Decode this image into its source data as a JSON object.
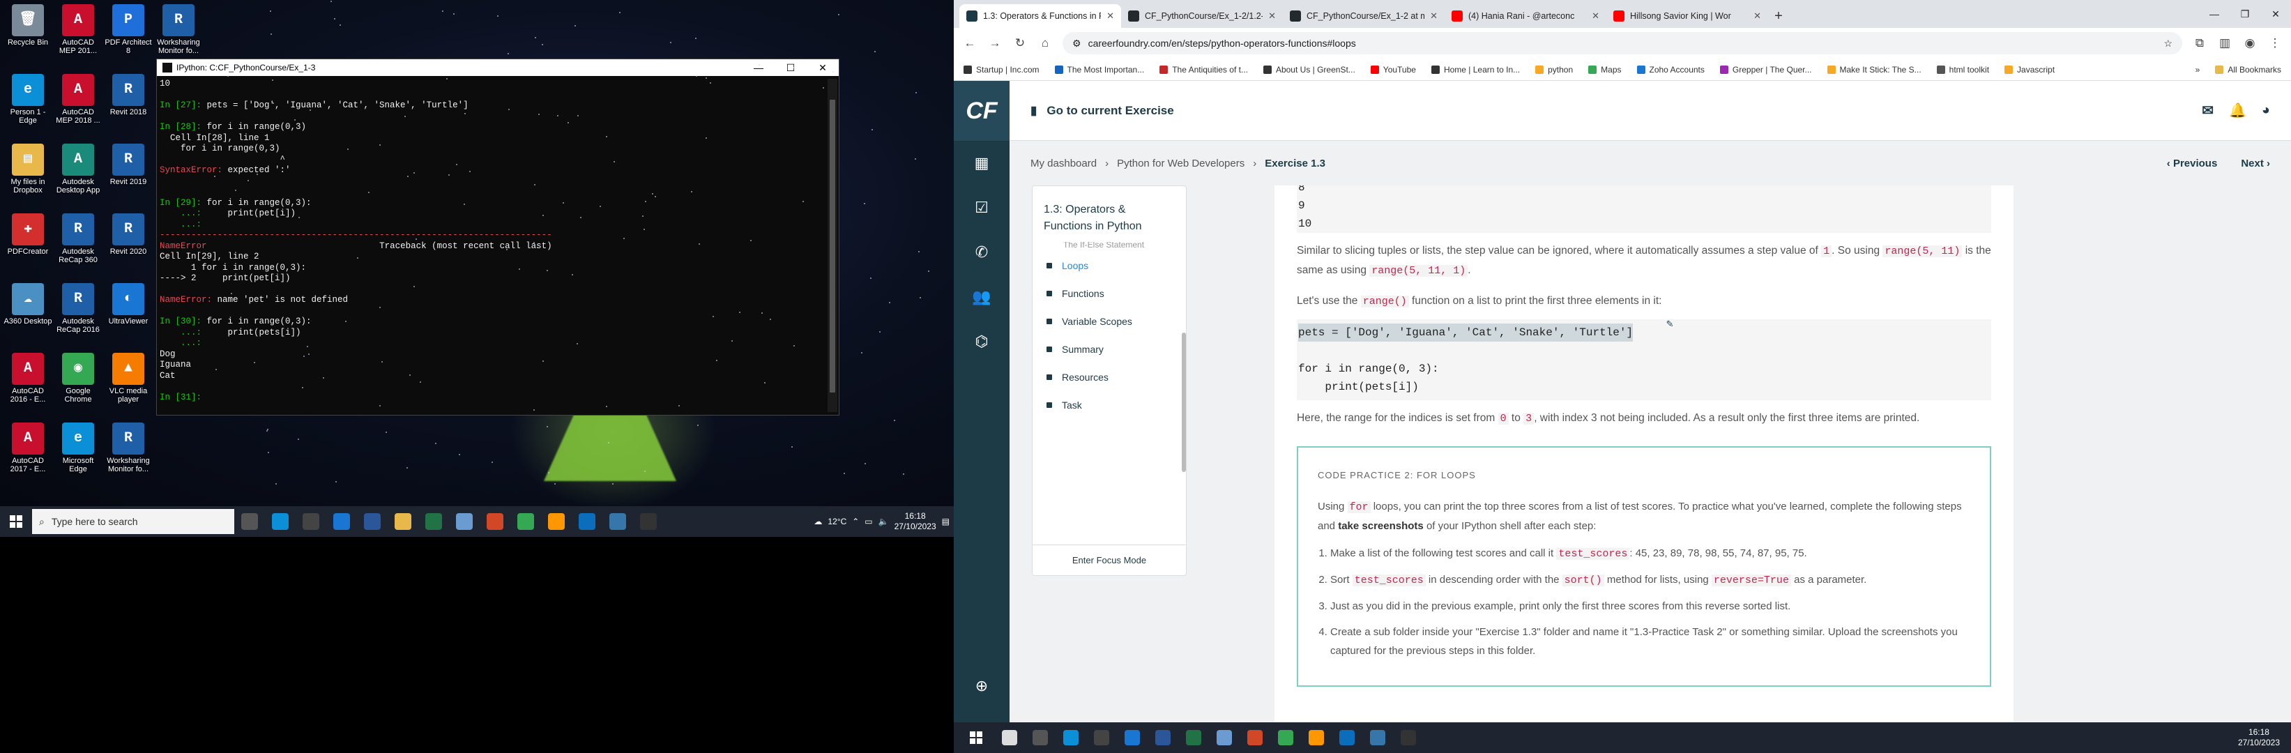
{
  "desktop": {
    "icons": [
      {
        "label": "Recycle Bin",
        "color": "#7a8a99",
        "glyph": "🗑"
      },
      {
        "label": "AutoCAD MEP 201...",
        "color": "#c8102e",
        "glyph": "A"
      },
      {
        "label": "PDF Architect 8",
        "color": "#1e6fd9",
        "glyph": "P"
      },
      {
        "label": "Worksharing Monitor fo...",
        "color": "#1e5fa8",
        "glyph": "R"
      },
      {
        "label": "Person 1 - Edge",
        "color": "#0b8fd6",
        "glyph": "e"
      },
      {
        "label": "AutoCAD MEP 2018 ...",
        "color": "#c8102e",
        "glyph": "A"
      },
      {
        "label": "Revit 2018",
        "color": "#1e5fa8",
        "glyph": "R"
      },
      {
        "label": "My files in Dropbox",
        "color": "#e8b84a",
        "glyph": "▤"
      },
      {
        "label": "Autodesk Desktop App",
        "color": "#1a8a7a",
        "glyph": "A"
      },
      {
        "label": "Revit 2019",
        "color": "#1e5fa8",
        "glyph": "R"
      },
      {
        "label": "PDFCreator",
        "color": "#d32f2f",
        "glyph": "✚"
      },
      {
        "label": "Autodesk ReCap 360",
        "color": "#1e5fa8",
        "glyph": "R"
      },
      {
        "label": "Revit 2020",
        "color": "#1e5fa8",
        "glyph": "R"
      },
      {
        "label": "A360 Desktop",
        "color": "#4a90c2",
        "glyph": "☁"
      },
      {
        "label": "Autodesk ReCap 2016",
        "color": "#1e5fa8",
        "glyph": "R"
      },
      {
        "label": "UltraViewer",
        "color": "#1976d2",
        "glyph": "◐"
      },
      {
        "label": "AutoCAD 2016 - E...",
        "color": "#c8102e",
        "glyph": "A"
      },
      {
        "label": "Google Chrome",
        "color": "#34a853",
        "glyph": "◉"
      },
      {
        "label": "VLC media player",
        "color": "#f57c00",
        "glyph": "▲"
      },
      {
        "label": "AutoCAD 2017 - E...",
        "color": "#c8102e",
        "glyph": "A"
      },
      {
        "label": "Microsoft Edge",
        "color": "#0b8fd6",
        "glyph": "e"
      },
      {
        "label": "Worksharing Monitor fo...",
        "color": "#1e5fa8",
        "glyph": "R"
      }
    ]
  },
  "ipython": {
    "title": "IPython: C:CF_PythonCourse/Ex_1-3",
    "lines": [
      {
        "c": "w",
        "t": "10"
      },
      {
        "c": "w",
        "t": ""
      },
      {
        "c": "g",
        "t": "In [27]: ",
        "r": "pets = ['Dog', 'Iguana', 'Cat', 'Snake', 'Turtle']"
      },
      {
        "c": "w",
        "t": ""
      },
      {
        "c": "g",
        "t": "In [28]: ",
        "r": "for i in range(0,3)"
      },
      {
        "c": "w",
        "t": "  Cell In[28], line 1"
      },
      {
        "c": "w",
        "t": "    for i in range(0,3)"
      },
      {
        "c": "w",
        "t": "                       ^"
      },
      {
        "c": "r",
        "t": "SyntaxError: ",
        "r": "expected ':'"
      },
      {
        "c": "w",
        "t": ""
      },
      {
        "c": "w",
        "t": ""
      },
      {
        "c": "g",
        "t": "In [29]: ",
        "r": "for i in range(0,3):"
      },
      {
        "c": "g",
        "t": "    ...:     ",
        "r": "print(pet[i])"
      },
      {
        "c": "g",
        "t": "    ...:"
      },
      {
        "c": "r",
        "t": "---------------------------------------------------------------------------"
      },
      {
        "c": "r",
        "t": "NameError                                 ",
        "r": "Traceback (most recent call last)"
      },
      {
        "c": "w",
        "t": "Cell In[29], line 2"
      },
      {
        "c": "w",
        "t": "      1 for i in range(0,3):"
      },
      {
        "c": "w",
        "t": "----> 2     print(pet[i])"
      },
      {
        "c": "w",
        "t": ""
      },
      {
        "c": "r",
        "t": "NameError: ",
        "r": "name 'pet' is not defined"
      },
      {
        "c": "w",
        "t": ""
      },
      {
        "c": "g",
        "t": "In [30]: ",
        "r": "for i in range(0,3):"
      },
      {
        "c": "g",
        "t": "    ...:     ",
        "r": "print(pets[i])"
      },
      {
        "c": "g",
        "t": "    ...:"
      },
      {
        "c": "w",
        "t": "Dog"
      },
      {
        "c": "w",
        "t": "Iguana"
      },
      {
        "c": "w",
        "t": "Cat"
      },
      {
        "c": "w",
        "t": ""
      },
      {
        "c": "g",
        "t": "In [31]: ",
        "r": ""
      }
    ]
  },
  "left_taskbar": {
    "search_placeholder": "Type here to search",
    "weather": "12°C",
    "time": "16:18",
    "date": "27/10/2023",
    "apps": [
      {
        "name": "task-view",
        "color": "#555"
      },
      {
        "name": "edge",
        "color": "#0b8fd6"
      },
      {
        "name": "store",
        "color": "#444"
      },
      {
        "name": "mail",
        "color": "#1976d2"
      },
      {
        "name": "word",
        "color": "#2b579a"
      },
      {
        "name": "explorer",
        "color": "#e8b84a"
      },
      {
        "name": "excel",
        "color": "#217346"
      },
      {
        "name": "notepad",
        "color": "#6a9bd1"
      },
      {
        "name": "powerpoint",
        "color": "#d24726"
      },
      {
        "name": "chrome",
        "color": "#34a853"
      },
      {
        "name": "sublime",
        "color": "#ff9800"
      },
      {
        "name": "vscode",
        "color": "#0a6ebd"
      },
      {
        "name": "python",
        "color": "#3776ab"
      },
      {
        "name": "terminal",
        "color": "#333"
      }
    ]
  },
  "browser": {
    "tabs": [
      {
        "label": "1.3: Operators & Functions in P",
        "color": "#1d3a47",
        "active": true
      },
      {
        "label": "CF_PythonCourse/Ex_1-2/1.2-F",
        "color": "#24292e",
        "active": false
      },
      {
        "label": "CF_PythonCourse/Ex_1-2 at ma",
        "color": "#24292e",
        "active": false
      },
      {
        "label": "(4) Hania Rani - @arteconc",
        "color": "#ff0000",
        "active": false
      },
      {
        "label": "Hillsong Savior King | Wor",
        "color": "#ff0000",
        "active": false
      }
    ],
    "url": "careerfoundry.com/en/steps/python-operators-functions#loops",
    "bookmarks": [
      {
        "label": "Startup | Inc.com",
        "color": "#333"
      },
      {
        "label": "The Most Importan...",
        "color": "#1565c0"
      },
      {
        "label": "The Antiquities of t...",
        "color": "#c62828"
      },
      {
        "label": "About Us | GreenSt...",
        "color": "#333"
      },
      {
        "label": "YouTube",
        "color": "#ff0000"
      },
      {
        "label": "Home | Learn to In...",
        "color": "#333"
      },
      {
        "label": "python",
        "color": "#f9a825"
      },
      {
        "label": "Maps",
        "color": "#34a853"
      },
      {
        "label": "Zoho Accounts",
        "color": "#1976d2"
      },
      {
        "label": "Grepper | The Quer...",
        "color": "#9c27b0"
      },
      {
        "label": "Make It Stick: The S...",
        "color": "#f9a825"
      },
      {
        "label": "html toolkit",
        "color": "#555"
      },
      {
        "label": "Javascript",
        "color": "#f9a825"
      }
    ],
    "all_bookmarks": "All Bookmarks"
  },
  "cf": {
    "header": "Go to current Exercise",
    "crumbs": [
      "My dashboard",
      "Python for Web Developers",
      "Exercise 1.3"
    ],
    "prev": "Previous",
    "next": "Next",
    "toc_title": "1.3: Operators & Functions in Python",
    "toc_partial": "The If-Else Statement",
    "toc_items": [
      "Loops",
      "Functions",
      "Variable Scopes",
      "Summary",
      "Resources",
      "Task"
    ],
    "focus_mode": "Enter Focus Mode",
    "code_top": [
      "8",
      "9",
      "10"
    ],
    "p1a": "Similar to slicing tuples or lists, the step value can be ignored, where it automatically assumes a step value of ",
    "p1_one": "1",
    "p1b": ". So using ",
    "p1_r1": "range(5, 11)",
    "p1c": " is the same as using ",
    "p1_r2": "range(5, 11, 1)",
    "p1d": ".",
    "p2a": "Let's use the ",
    "p2_fn": "range()",
    "p2b": " function on a list to print the first three elements in it:",
    "code1": "pets = ['Dog', 'Iguana', 'Cat', 'Snake', 'Turtle']",
    "code2": "for i in range(0, 3):",
    "code3": "    print(pets[i])",
    "p3a": "Here, the range for the indices is set from ",
    "p3_0": "0",
    "p3b": " to ",
    "p3_3": "3",
    "p3c": ", with index 3 not being included. As a result only the first three items are printed.",
    "practice_label": "CODE PRACTICE 2: FOR LOOPS",
    "pr_a": "Using ",
    "pr_for": "for",
    "pr_b": " loops, you can print the top three scores from a list of test scores. To practice what you've learned, complete the following steps and ",
    "pr_bold": "take screenshots",
    "pr_c": " of your IPython shell after each step:",
    "step1a": "Make a list of the following test scores and call it ",
    "step1_var": "test_scores",
    "step1b": ": 45, 23, 89, 78, 98, 55, 74, 87, 95, 75.",
    "step2a": "Sort ",
    "step2_var": "test_scores",
    "step2b": " in descending order with the ",
    "step2_fn": "sort()",
    "step2c": " method for lists, using ",
    "step2_kw": "reverse=True",
    "step2d": " as a parameter.",
    "step3": "Just as you did in the previous example, print only the first three scores from this reverse sorted list.",
    "step4": "Create a sub folder inside your \"Exercise 1.3\" folder and name it \"1.3-Practice Task 2\" or something similar. Upload the screenshots you captured for the previous steps in this folder."
  },
  "right_taskbar": {
    "time": "16:18",
    "date": "27/10/2023",
    "apps": [
      {
        "name": "search",
        "color": "#ddd"
      },
      {
        "name": "task-view",
        "color": "#555"
      },
      {
        "name": "edge",
        "color": "#0b8fd6"
      },
      {
        "name": "store",
        "color": "#444"
      },
      {
        "name": "mail",
        "color": "#1976d2"
      },
      {
        "name": "word",
        "color": "#2b579a"
      },
      {
        "name": "excel",
        "color": "#217346"
      },
      {
        "name": "notepad",
        "color": "#6a9bd1"
      },
      {
        "name": "powerpoint",
        "color": "#d24726"
      },
      {
        "name": "chrome",
        "color": "#34a853"
      },
      {
        "name": "sublime",
        "color": "#ff9800"
      },
      {
        "name": "vscode",
        "color": "#0a6ebd"
      },
      {
        "name": "python",
        "color": "#3776ab"
      },
      {
        "name": "terminal",
        "color": "#333"
      }
    ]
  }
}
